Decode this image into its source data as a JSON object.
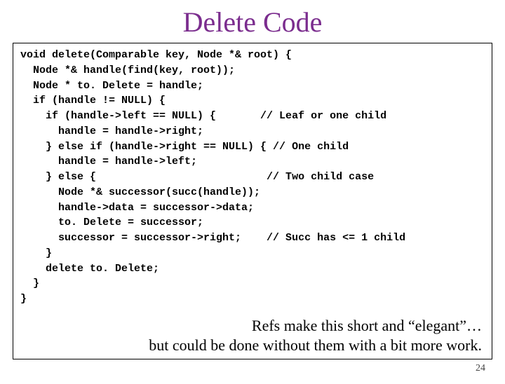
{
  "title": "Delete Code",
  "code": {
    "l01": "void delete(Comparable key, Node *& root) {",
    "l02": "  Node *& handle(find(key, root));",
    "l03": "  Node * to. Delete = handle;",
    "l04": "  if (handle != NULL) {",
    "l05": "    if (handle->left == NULL) {       // Leaf or one child",
    "l06": "      handle = handle->right;",
    "l07": "    } else if (handle->right == NULL) { // One child",
    "l08": "      handle = handle->left;",
    "l09": "    } else {                           // Two child case",
    "l10": "      Node *& successor(succ(handle));",
    "l11": "      handle->data = successor->data;",
    "l12": "      to. Delete = successor;",
    "l13": "      successor = successor->right;    // Succ has <= 1 child",
    "l14": "    }",
    "l15": "    delete to. Delete;",
    "l16": "  }",
    "l17": "}"
  },
  "caption_line1": "Refs make this short and “elegant”…",
  "caption_line2": "but could be done without them with a bit more work.",
  "page_number": "24"
}
